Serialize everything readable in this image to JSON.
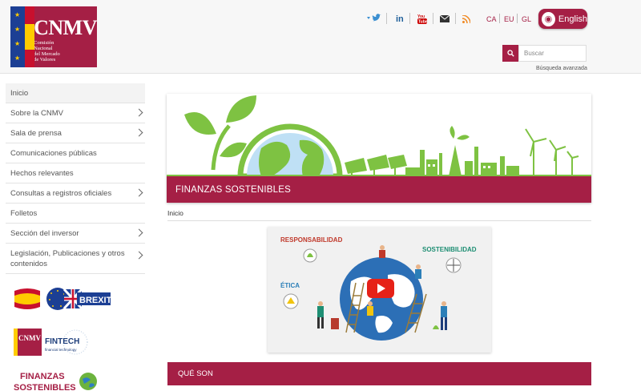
{
  "header": {
    "logo": {
      "title": "CNMV",
      "subtitle_lines": [
        "Comisión",
        "Nacional",
        "del Mercado",
        "de Valores"
      ]
    },
    "social_icons": [
      "twitter-icon",
      "linkedin-icon",
      "youtube-icon",
      "mail-icon",
      "rss-icon"
    ],
    "languages": [
      "CA",
      "EU",
      "GL"
    ],
    "english_label": "English",
    "search": {
      "placeholder": "Buscar",
      "advanced_label": "Búsqueda avanzada"
    }
  },
  "sidebar": {
    "items": [
      {
        "label": "Inicio",
        "has_children": false
      },
      {
        "label": "Sobre la CNMV",
        "has_children": true
      },
      {
        "label": "Sala de prensa",
        "has_children": true
      },
      {
        "label": "Comunicaciones públicas",
        "has_children": false
      },
      {
        "label": "Hechos relevantes",
        "has_children": false
      },
      {
        "label": "Consultas a registros oficiales",
        "has_children": true
      },
      {
        "label": "Folletos",
        "has_children": false
      },
      {
        "label": "Sección del inversor",
        "has_children": true
      },
      {
        "label": "Legislación, Publicaciones y otros contenidos",
        "has_children": true
      }
    ],
    "promos": {
      "brexit": "BREXIT",
      "fintech_logo": "CNMV",
      "fintech_title": "FINTECH",
      "fintech_sub": "financial technology",
      "finanzas_line1": "FINANZAS",
      "finanzas_line2": "SOSTENIBLES"
    }
  },
  "main": {
    "banner_title": "FINANZAS SOSTENIBLES",
    "breadcrumb": "Inicio",
    "video_labels": {
      "responsabilidad": "RESPONSABILIDAD",
      "sostenibilidad": "SOSTENIBILIDAD",
      "etica": "ÉTICA"
    },
    "section_title": "QUÉ SON"
  },
  "colors": {
    "brand": "#a51f45",
    "green": "#7ec242",
    "sky": "#bfe0f5"
  }
}
